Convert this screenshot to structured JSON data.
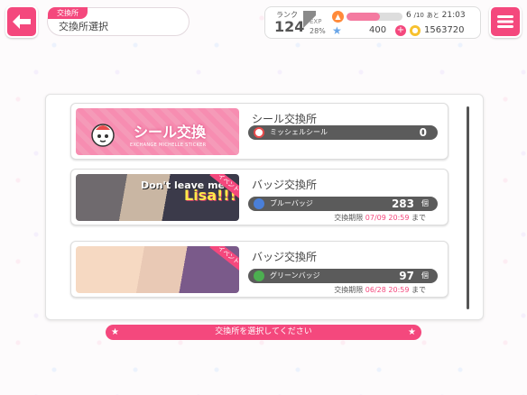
{
  "header": {
    "breadcrumb_small": "交換所",
    "breadcrumb_title": "交換所選択"
  },
  "status": {
    "rank_label": "ランク",
    "rank_value": "124",
    "exp_label": "EXP",
    "exp_percent": "28%",
    "exp_fraction": 0.28,
    "stamina_current": "6",
    "stamina_max": "/10",
    "stamina_fraction": 0.6,
    "stamina_timer_label": "あと",
    "stamina_timer": "21:03",
    "stars": "400",
    "coins": "1563720",
    "accent": "#f4487d"
  },
  "exchanges": [
    {
      "title": "シール交換所",
      "banner_text": "シール交換",
      "banner_sub": "EXCHANGE MICHELLE STICKER",
      "item_name": "ミッシェルシール",
      "count": "0",
      "unit": "",
      "deadline_label": "",
      "deadline": "",
      "deadline_suffix": ""
    },
    {
      "title": "バッジ交換所",
      "banner_text_1": "Don't leave me",
      "banner_text_2": "Lisa!!!",
      "event_label": "イベント",
      "item_name": "ブルーバッジ",
      "item_color": "#4a7fd8",
      "count": "283",
      "unit": "個",
      "deadline_label": "交換期限",
      "deadline": "07/09 20:59",
      "deadline_suffix": "まで"
    },
    {
      "title": "バッジ交換所",
      "event_label": "イベント",
      "item_name": "グリーンバッジ",
      "item_color": "#4caf50",
      "count": "97",
      "unit": "個",
      "deadline_label": "交換期限",
      "deadline": "06/28 20:59",
      "deadline_suffix": "まで"
    }
  ],
  "footer": {
    "prompt": "交換所を選択してください"
  }
}
